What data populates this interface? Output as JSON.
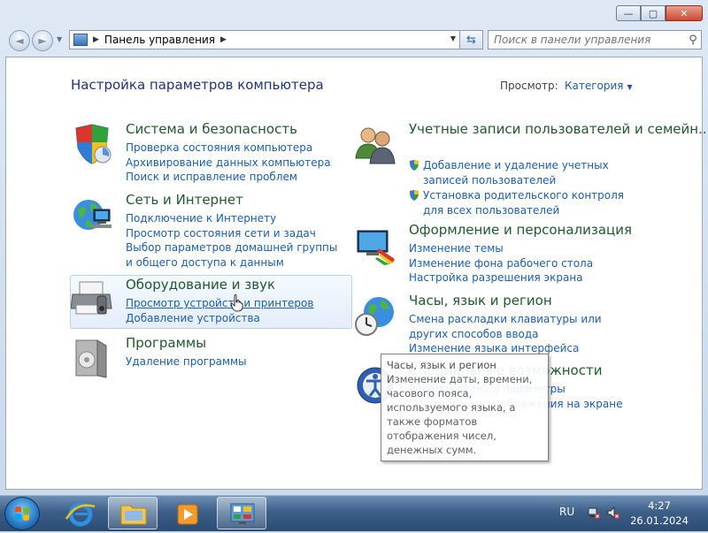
{
  "window": {
    "min_glyph": "—",
    "max_glyph": "▢",
    "close_glyph": "✕"
  },
  "nav": {
    "back_glyph": "◄",
    "forward_glyph": "►",
    "breadcrumb": "Панель управления",
    "search_placeholder": "Поиск в панели управления"
  },
  "header": {
    "title": "Настройка параметров компьютера",
    "view_label": "Просмотр:",
    "view_value": "Категория"
  },
  "categories": {
    "system": {
      "title": "Система и безопасность",
      "links": [
        "Проверка состояния компьютера",
        "Архивирование данных компьютера",
        "Поиск и исправление проблем"
      ]
    },
    "network": {
      "title": "Сеть и Интернет",
      "links": [
        "Подключение к Интернету",
        "Просмотр состояния сети и задач",
        "Выбор параметров домашней группы и общего доступа к данным"
      ]
    },
    "hardware": {
      "title": "Оборудование и звук",
      "links": [
        "Просмотр устройств и принтеров",
        "Добавление устройства"
      ]
    },
    "programs": {
      "title": "Программы",
      "links": [
        "Удаление программы"
      ]
    },
    "accounts": {
      "title": "Учетные записи пользователей и семейн...",
      "links": [
        "Добавление и удаление учетных записей пользователей",
        "Установка родительского контроля для всех пользователей"
      ]
    },
    "appearance": {
      "title": "Оформление и персонализация",
      "links": [
        "Изменение темы",
        "Изменение фона рабочего стола",
        "Настройка разрешения экрана"
      ]
    },
    "clock": {
      "title": "Часы, язык и регион",
      "links": [
        "Смена раскладки клавиатуры или других способов ввода",
        "Изменение языка интерфейса"
      ]
    },
    "ease": {
      "title": "Специальные возможности",
      "links": [
        "Рекомендуемые параметры",
        "Оптимизация изображения на экране"
      ]
    }
  },
  "tooltip": {
    "title": "Часы, язык и регион",
    "body": "Изменение даты, времени, часового пояса, используемого языка, а также форматов отображения чисел, денежных сумм."
  },
  "taskbar": {
    "language": "RU",
    "time": "4:27",
    "date": "26.01.2024"
  },
  "colors": {
    "category_title": "#1e5a2c",
    "link": "#1a5fb4",
    "page_title": "#1e3287"
  }
}
